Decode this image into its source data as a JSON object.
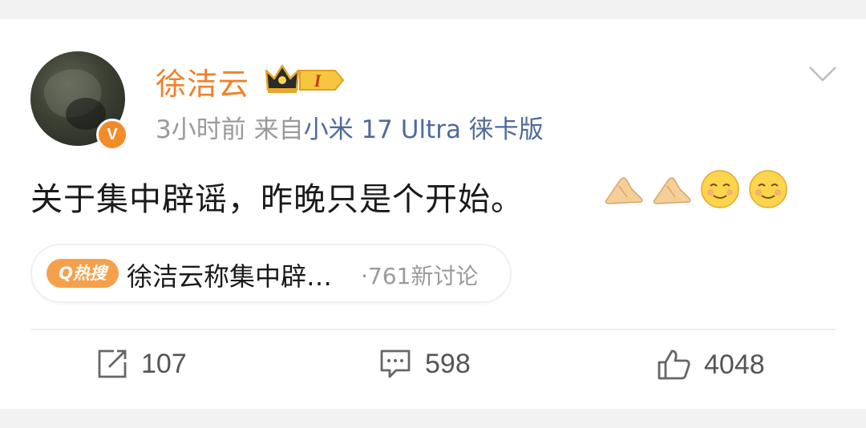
{
  "post": {
    "username": "徐洁云",
    "vip_level": "I",
    "verified_mark": "V",
    "time": "3小时前",
    "source_prefix": "来自",
    "source": "小米 17 Ultra 徕卡版",
    "text": "关于集中辟谣，昨晚只是个开始。",
    "emojis": [
      "pray-hands-icon",
      "pray-hands-icon",
      "smile-face-icon",
      "smile-face-icon"
    ]
  },
  "hot_search": {
    "badge": "Q热搜",
    "title": "徐洁云称集中辟…",
    "count": "·761新讨论"
  },
  "actions": {
    "share_count": "107",
    "comment_count": "598",
    "like_count": "4048"
  },
  "colors": {
    "username": "#f0812b",
    "source": "#4f6b9b",
    "badge": "#f6a04b",
    "verified": "#f38b2a"
  }
}
